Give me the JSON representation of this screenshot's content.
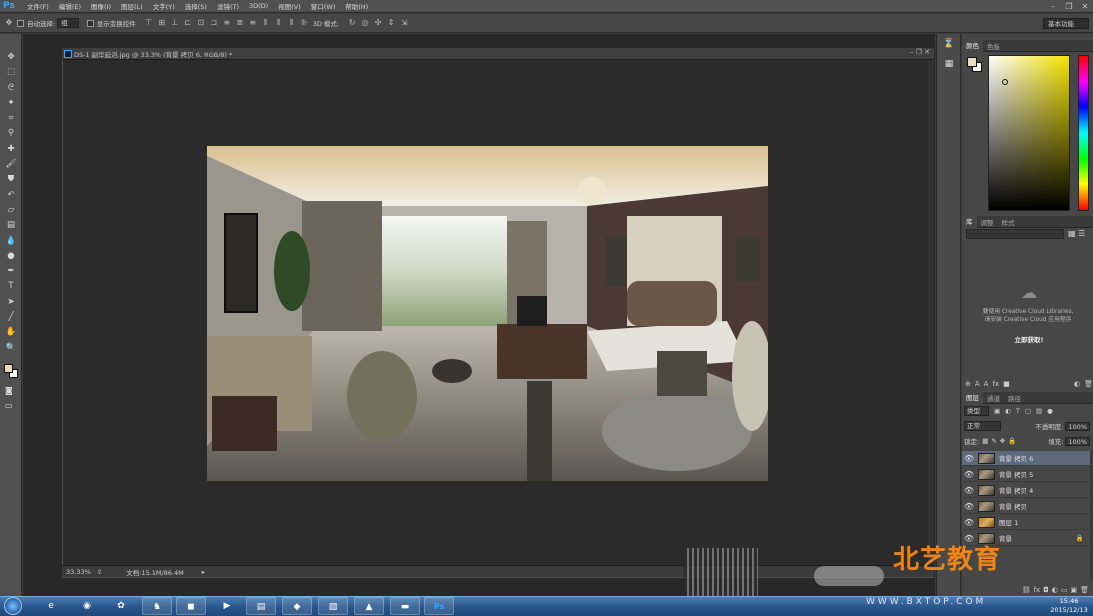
{
  "app": {
    "logo": "Ps"
  },
  "menu": [
    "文件(F)",
    "编辑(E)",
    "图像(I)",
    "图层(L)",
    "文字(Y)",
    "选择(S)",
    "滤镜(T)",
    "3D(D)",
    "视图(V)",
    "窗口(W)",
    "帮助(H)"
  ],
  "options_bar": {
    "auto_select_label": "自动选择:",
    "auto_select_value": "组",
    "show_transform_label": "显示变换控件",
    "mode_3d_label": "3D 模式:",
    "workspace": "基本功能"
  },
  "document": {
    "title": "DS-1 副华延滔.jpg @ 33.3% (背景 拷贝 6, RGB/8) *",
    "zoom": "33.33%",
    "doc_size": "文档:15.1M/86.4M"
  },
  "color_panel": {
    "tabs": [
      "颜色",
      "色板"
    ],
    "foreground": "#e7dfc3",
    "background": "#ffffff"
  },
  "libraries_panel": {
    "tabs": [
      "库",
      "调整",
      "样式"
    ],
    "message_line1": "要使用 Creative Cloud Libraries,",
    "message_line2": "请安装 Creative Cloud 应用程序",
    "button": "立即获取!"
  },
  "layers_panel": {
    "tabs": [
      "图层",
      "通道",
      "路径"
    ],
    "filter": "类型",
    "blend_mode": "正常",
    "opacity_label": "不透明度:",
    "opacity": "100%",
    "lock_label": "锁定:",
    "fill_label": "填充:",
    "fill": "100%",
    "layers": [
      {
        "name": "背景 拷贝 6",
        "active": true
      },
      {
        "name": "背景 拷贝 5",
        "active": false
      },
      {
        "name": "背景 拷贝 4",
        "active": false
      },
      {
        "name": "背景 拷贝",
        "active": false
      },
      {
        "name": "图层 1",
        "active": false
      },
      {
        "name": "背景",
        "active": false
      }
    ]
  },
  "taskbar": {
    "time": "15:46",
    "date": "2015/12/13"
  },
  "watermark": {
    "text": "北艺教育",
    "url": "WWW.BXTOP.COM"
  }
}
